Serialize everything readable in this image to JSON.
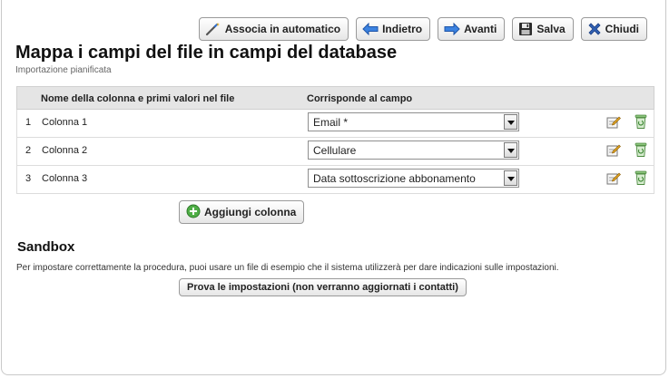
{
  "toolbar": {
    "auto_label": "Associa in automatico",
    "back_label": "Indietro",
    "next_label": "Avanti",
    "save_label": "Salva",
    "close_label": "Chiudi"
  },
  "page": {
    "title": "Mappa i campi del file in campi del database",
    "subtitle": "Importazione pianificata"
  },
  "mapping": {
    "headers": {
      "column": "Nome della colonna e primi valori nel file",
      "field": "Corrisponde al campo"
    },
    "rows": [
      {
        "num": "1",
        "column": "Colonna 1",
        "field": "Email *"
      },
      {
        "num": "2",
        "column": "Colonna 2",
        "field": "Cellulare"
      },
      {
        "num": "3",
        "column": "Colonna 3",
        "field": "Data sottoscrizione abbonamento"
      }
    ],
    "add_column_label": "Aggiungi colonna"
  },
  "sandbox": {
    "title": "Sandbox",
    "description": "Per impostare correttamente la procedura, puoi usare un file di esempio che il sistema utilizzerà per dare indicazioni sulle impostazioni.",
    "test_button_label": "Prova le impostazioni (non verranno aggiornati i contatti)"
  },
  "icons": {
    "auto": "wand-icon",
    "back": "arrow-left-icon",
    "next": "arrow-right-icon",
    "save": "floppy-disk-icon",
    "close": "close-x-icon",
    "edit": "edit-icon",
    "delete": "trash-icon",
    "add": "plus-circle-icon"
  },
  "colors": {
    "header_bg": "#e5e5e5",
    "arrow_blue": "#2d6fd6",
    "close_blue": "#2f5fb3",
    "add_green": "#3f9b3a"
  }
}
